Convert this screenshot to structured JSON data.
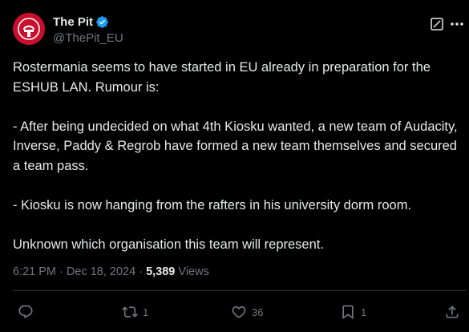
{
  "author": {
    "display_name": "The Pit",
    "handle": "@ThePit_EU",
    "verified": true,
    "avatar_color": "#c8102e"
  },
  "tweet": {
    "paragraphs": [
      "Rostermania seems to have started in EU already in preparation for the ESHUB LAN. Rumour is:",
      "- After being undecided on what 4th Kiosku wanted, a new team of Audacity, Inverse, Paddy & Regrob have formed a new team themselves and secured a team pass.",
      "-  Kiosku is now hanging from the rafters in his university dorm room.",
      "Unknown which organisation this team will represent."
    ]
  },
  "meta": {
    "time": "6:21 PM",
    "separator": "·",
    "date": "Dec 18, 2024",
    "views_count": "5,389",
    "views_label": "Views"
  },
  "actions": {
    "reply_count": "",
    "retweet_count": "1",
    "like_count": "36",
    "bookmark_count": "1"
  },
  "colors": {
    "background": "#000000",
    "text": "#e7e9ea",
    "secondary": "#71767b",
    "verified": "#1d9bf0",
    "divider": "#2f3336"
  },
  "icons": {
    "verified": "verified-badge-icon",
    "grok": "grok-icon",
    "more": "more-icon",
    "reply": "reply-icon",
    "retweet": "retweet-icon",
    "like": "heart-icon",
    "bookmark": "bookmark-icon",
    "share": "share-icon"
  }
}
